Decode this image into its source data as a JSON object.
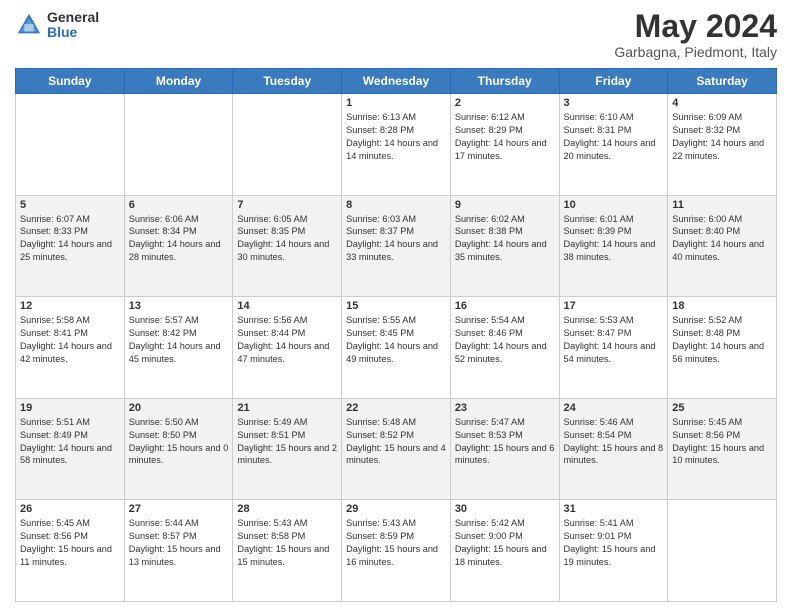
{
  "logo": {
    "general": "General",
    "blue": "Blue"
  },
  "header": {
    "month": "May 2024",
    "location": "Garbagna, Piedmont, Italy"
  },
  "weekdays": [
    "Sunday",
    "Monday",
    "Tuesday",
    "Wednesday",
    "Thursday",
    "Friday",
    "Saturday"
  ],
  "weeks": [
    [
      {
        "day": "",
        "sunrise": "",
        "sunset": "",
        "daylight": ""
      },
      {
        "day": "",
        "sunrise": "",
        "sunset": "",
        "daylight": ""
      },
      {
        "day": "",
        "sunrise": "",
        "sunset": "",
        "daylight": ""
      },
      {
        "day": "1",
        "sunrise": "Sunrise: 6:13 AM",
        "sunset": "Sunset: 8:28 PM",
        "daylight": "Daylight: 14 hours and 14 minutes."
      },
      {
        "day": "2",
        "sunrise": "Sunrise: 6:12 AM",
        "sunset": "Sunset: 8:29 PM",
        "daylight": "Daylight: 14 hours and 17 minutes."
      },
      {
        "day": "3",
        "sunrise": "Sunrise: 6:10 AM",
        "sunset": "Sunset: 8:31 PM",
        "daylight": "Daylight: 14 hours and 20 minutes."
      },
      {
        "day": "4",
        "sunrise": "Sunrise: 6:09 AM",
        "sunset": "Sunset: 8:32 PM",
        "daylight": "Daylight: 14 hours and 22 minutes."
      }
    ],
    [
      {
        "day": "5",
        "sunrise": "Sunrise: 6:07 AM",
        "sunset": "Sunset: 8:33 PM",
        "daylight": "Daylight: 14 hours and 25 minutes."
      },
      {
        "day": "6",
        "sunrise": "Sunrise: 6:06 AM",
        "sunset": "Sunset: 8:34 PM",
        "daylight": "Daylight: 14 hours and 28 minutes."
      },
      {
        "day": "7",
        "sunrise": "Sunrise: 6:05 AM",
        "sunset": "Sunset: 8:35 PM",
        "daylight": "Daylight: 14 hours and 30 minutes."
      },
      {
        "day": "8",
        "sunrise": "Sunrise: 6:03 AM",
        "sunset": "Sunset: 8:37 PM",
        "daylight": "Daylight: 14 hours and 33 minutes."
      },
      {
        "day": "9",
        "sunrise": "Sunrise: 6:02 AM",
        "sunset": "Sunset: 8:38 PM",
        "daylight": "Daylight: 14 hours and 35 minutes."
      },
      {
        "day": "10",
        "sunrise": "Sunrise: 6:01 AM",
        "sunset": "Sunset: 8:39 PM",
        "daylight": "Daylight: 14 hours and 38 minutes."
      },
      {
        "day": "11",
        "sunrise": "Sunrise: 6:00 AM",
        "sunset": "Sunset: 8:40 PM",
        "daylight": "Daylight: 14 hours and 40 minutes."
      }
    ],
    [
      {
        "day": "12",
        "sunrise": "Sunrise: 5:58 AM",
        "sunset": "Sunset: 8:41 PM",
        "daylight": "Daylight: 14 hours and 42 minutes."
      },
      {
        "day": "13",
        "sunrise": "Sunrise: 5:57 AM",
        "sunset": "Sunset: 8:42 PM",
        "daylight": "Daylight: 14 hours and 45 minutes."
      },
      {
        "day": "14",
        "sunrise": "Sunrise: 5:56 AM",
        "sunset": "Sunset: 8:44 PM",
        "daylight": "Daylight: 14 hours and 47 minutes."
      },
      {
        "day": "15",
        "sunrise": "Sunrise: 5:55 AM",
        "sunset": "Sunset: 8:45 PM",
        "daylight": "Daylight: 14 hours and 49 minutes."
      },
      {
        "day": "16",
        "sunrise": "Sunrise: 5:54 AM",
        "sunset": "Sunset: 8:46 PM",
        "daylight": "Daylight: 14 hours and 52 minutes."
      },
      {
        "day": "17",
        "sunrise": "Sunrise: 5:53 AM",
        "sunset": "Sunset: 8:47 PM",
        "daylight": "Daylight: 14 hours and 54 minutes."
      },
      {
        "day": "18",
        "sunrise": "Sunrise: 5:52 AM",
        "sunset": "Sunset: 8:48 PM",
        "daylight": "Daylight: 14 hours and 56 minutes."
      }
    ],
    [
      {
        "day": "19",
        "sunrise": "Sunrise: 5:51 AM",
        "sunset": "Sunset: 8:49 PM",
        "daylight": "Daylight: 14 hours and 58 minutes."
      },
      {
        "day": "20",
        "sunrise": "Sunrise: 5:50 AM",
        "sunset": "Sunset: 8:50 PM",
        "daylight": "Daylight: 15 hours and 0 minutes."
      },
      {
        "day": "21",
        "sunrise": "Sunrise: 5:49 AM",
        "sunset": "Sunset: 8:51 PM",
        "daylight": "Daylight: 15 hours and 2 minutes."
      },
      {
        "day": "22",
        "sunrise": "Sunrise: 5:48 AM",
        "sunset": "Sunset: 8:52 PM",
        "daylight": "Daylight: 15 hours and 4 minutes."
      },
      {
        "day": "23",
        "sunrise": "Sunrise: 5:47 AM",
        "sunset": "Sunset: 8:53 PM",
        "daylight": "Daylight: 15 hours and 6 minutes."
      },
      {
        "day": "24",
        "sunrise": "Sunrise: 5:46 AM",
        "sunset": "Sunset: 8:54 PM",
        "daylight": "Daylight: 15 hours and 8 minutes."
      },
      {
        "day": "25",
        "sunrise": "Sunrise: 5:45 AM",
        "sunset": "Sunset: 8:56 PM",
        "daylight": "Daylight: 15 hours and 10 minutes."
      }
    ],
    [
      {
        "day": "26",
        "sunrise": "Sunrise: 5:45 AM",
        "sunset": "Sunset: 8:56 PM",
        "daylight": "Daylight: 15 hours and 11 minutes."
      },
      {
        "day": "27",
        "sunrise": "Sunrise: 5:44 AM",
        "sunset": "Sunset: 8:57 PM",
        "daylight": "Daylight: 15 hours and 13 minutes."
      },
      {
        "day": "28",
        "sunrise": "Sunrise: 5:43 AM",
        "sunset": "Sunset: 8:58 PM",
        "daylight": "Daylight: 15 hours and 15 minutes."
      },
      {
        "day": "29",
        "sunrise": "Sunrise: 5:43 AM",
        "sunset": "Sunset: 8:59 PM",
        "daylight": "Daylight: 15 hours and 16 minutes."
      },
      {
        "day": "30",
        "sunrise": "Sunrise: 5:42 AM",
        "sunset": "Sunset: 9:00 PM",
        "daylight": "Daylight: 15 hours and 18 minutes."
      },
      {
        "day": "31",
        "sunrise": "Sunrise: 5:41 AM",
        "sunset": "Sunset: 9:01 PM",
        "daylight": "Daylight: 15 hours and 19 minutes."
      },
      {
        "day": "",
        "sunrise": "",
        "sunset": "",
        "daylight": ""
      }
    ]
  ]
}
